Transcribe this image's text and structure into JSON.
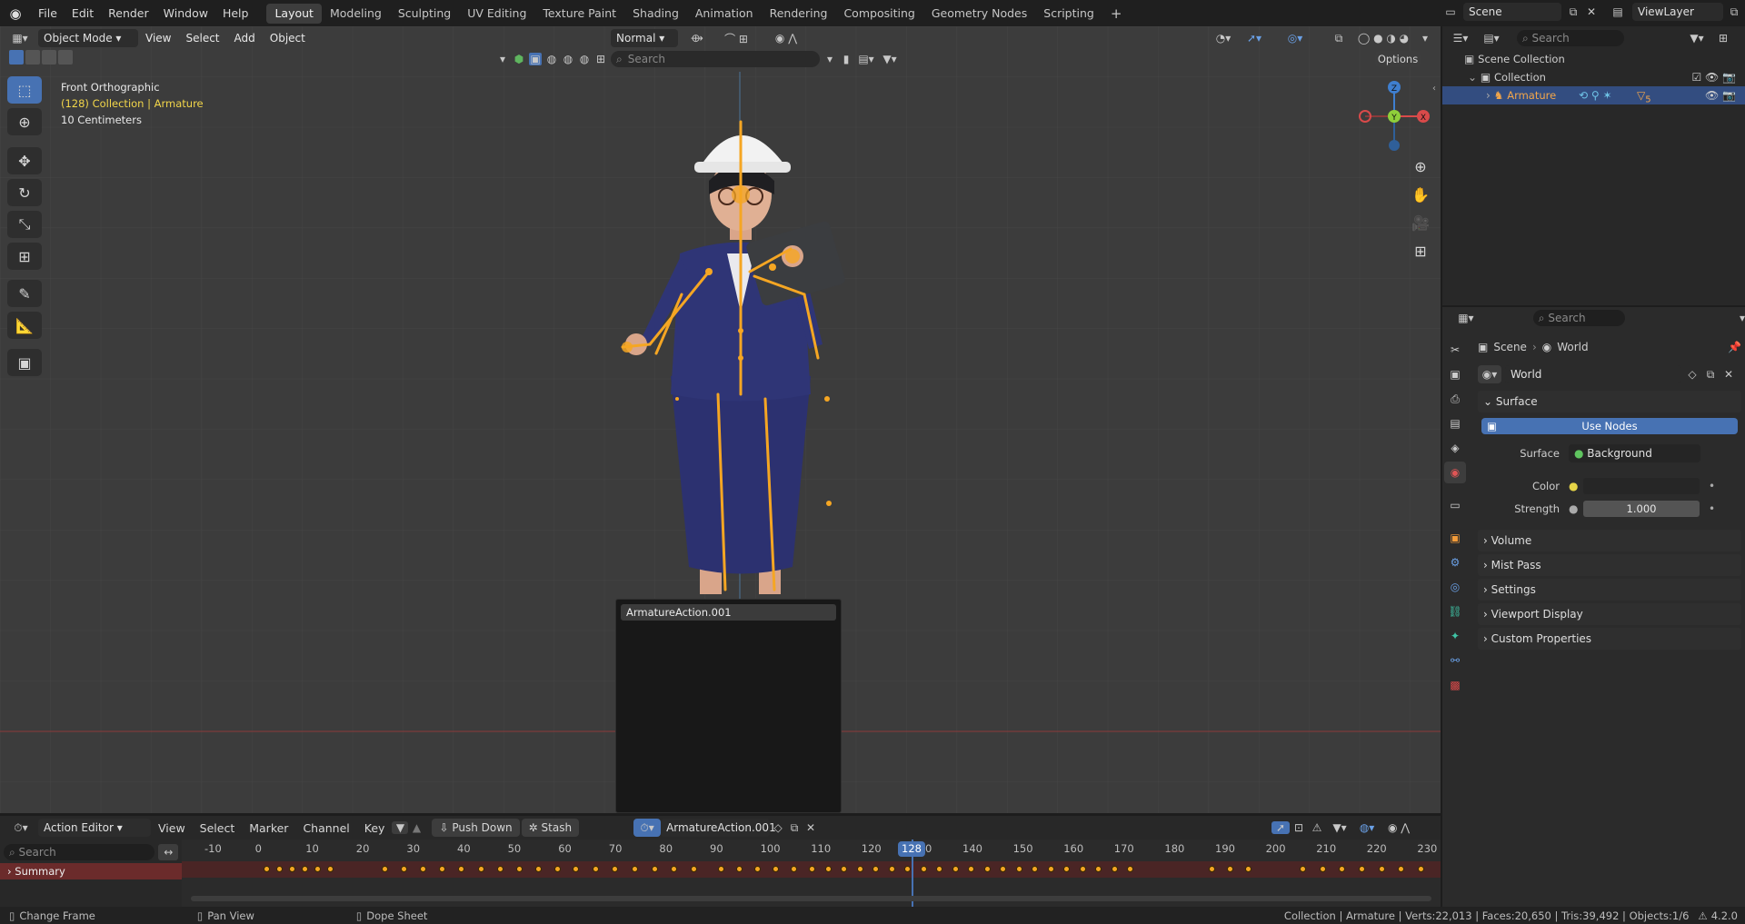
{
  "app": {
    "name": "Blender",
    "version": "4.2.0"
  },
  "top_menu": [
    "File",
    "Edit",
    "Render",
    "Window",
    "Help"
  ],
  "workspace_tabs": [
    {
      "label": "Layout",
      "active": true
    },
    {
      "label": "Modeling",
      "active": false
    },
    {
      "label": "Sculpting",
      "active": false
    },
    {
      "label": "UV Editing",
      "active": false
    },
    {
      "label": "Texture Paint",
      "active": false
    },
    {
      "label": "Shading",
      "active": false
    },
    {
      "label": "Animation",
      "active": false
    },
    {
      "label": "Rendering",
      "active": false
    },
    {
      "label": "Compositing",
      "active": false
    },
    {
      "label": "Geometry Nodes",
      "active": false
    },
    {
      "label": "Scripting",
      "active": false
    }
  ],
  "add_workspace": "+",
  "scene_selector": {
    "value": "Scene"
  },
  "viewlayer_selector": {
    "value": "ViewLayer"
  },
  "viewport": {
    "mode": "Object Mode",
    "menus": [
      "View",
      "Select",
      "Add",
      "Object"
    ],
    "orientation": "Normal",
    "search_placeholder": "Search",
    "options_label": "Options",
    "overlay_view": "Front Orthographic",
    "overlay_collection": "(128) Collection | Armature",
    "overlay_scale": "10 Centimeters",
    "gizmo_axes": {
      "z": "Z",
      "y": "Y",
      "x": "X"
    }
  },
  "action_popup": {
    "item": "ArmatureAction.001",
    "search_value": ""
  },
  "outliner": {
    "search_placeholder": "Search",
    "items": [
      {
        "label": "Scene Collection",
        "level": 0
      },
      {
        "label": "Collection",
        "level": 1
      },
      {
        "label": "Armature",
        "level": 2,
        "selected": true
      }
    ],
    "armature_badge": "5"
  },
  "properties": {
    "search_placeholder": "Search",
    "breadcrumb": [
      "Scene",
      "World"
    ],
    "world_name": "World",
    "surface_section": "Surface",
    "use_nodes_label": "Use Nodes",
    "surface_label": "Surface",
    "surface_value": "Background",
    "color_label": "Color",
    "strength_label": "Strength",
    "strength_value": "1.000",
    "sections": [
      "Volume",
      "Mist Pass",
      "Settings",
      "Viewport Display",
      "Custom Properties"
    ]
  },
  "action_editor": {
    "editor_type": "Action Editor",
    "menus": [
      "View",
      "Select",
      "Marker",
      "Channel",
      "Key"
    ],
    "push_down": "Push Down",
    "stash": "Stash",
    "action_name": "ArmatureAction.001",
    "search_placeholder": "Search",
    "channel": "Summary",
    "current_frame": "128",
    "ruler_labels": [
      "-10",
      "0",
      "10",
      "20",
      "30",
      "40",
      "50",
      "60",
      "70",
      "80",
      "90",
      "100",
      "110",
      "120",
      "130",
      "140",
      "150",
      "160",
      "170",
      "180",
      "190",
      "200",
      "210",
      "220",
      "230"
    ]
  },
  "statusbar": {
    "left": [
      {
        "label": "Change Frame"
      },
      {
        "label": "Pan View"
      },
      {
        "label": "Dope Sheet"
      }
    ],
    "stats": "Collection | Armature | Verts:22,013 | Faces:20,650 | Tris:39,492 | Objects:1/6",
    "version": "4.2.0"
  },
  "colors": {
    "accent": "#4772b3",
    "bone": "#f5a623",
    "selected_text": "#f3a64a",
    "overlay_yellow": "#f2d64a"
  }
}
